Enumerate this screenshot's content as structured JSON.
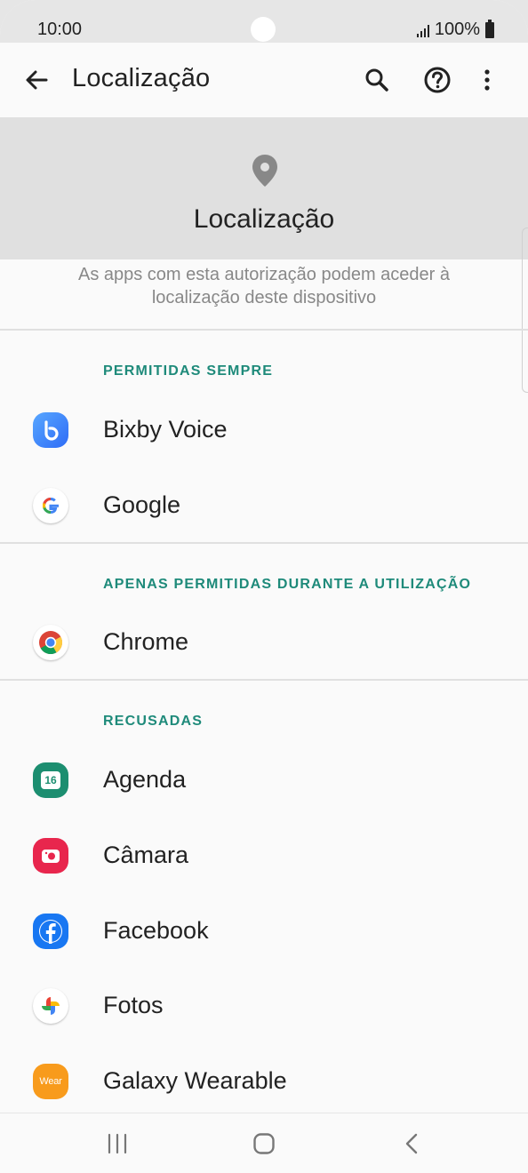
{
  "status": {
    "time": "10:00",
    "battery": "100%"
  },
  "appbar": {
    "title": "Localização",
    "icons": [
      "back-arrow-icon",
      "search-icon",
      "help-icon",
      "more-vert-icon"
    ]
  },
  "header": {
    "title": "Localização",
    "icon": "location-pin-icon"
  },
  "description": "As apps com esta autorização podem aceder à localização deste dispositivo",
  "sections": {
    "always": {
      "label": "PERMITIDAS SEMPRE",
      "apps": [
        {
          "name": "Bixby Voice",
          "icon": "bixby-voice-icon"
        },
        {
          "name": "Google",
          "icon": "google-icon"
        }
      ]
    },
    "while_using": {
      "label": "APENAS PERMITIDAS DURANTE A UTILIZAÇÃO",
      "apps": [
        {
          "name": "Chrome",
          "icon": "chrome-icon"
        }
      ]
    },
    "denied": {
      "label": "RECUSADAS",
      "apps": [
        {
          "name": "Agenda",
          "icon": "calendar-icon",
          "badge": "16"
        },
        {
          "name": "Câmara",
          "icon": "camera-icon"
        },
        {
          "name": "Facebook",
          "icon": "facebook-icon"
        },
        {
          "name": "Fotos",
          "icon": "photos-icon"
        },
        {
          "name": "Galaxy Wearable",
          "icon": "wear-icon",
          "badge": "Wear"
        }
      ]
    }
  },
  "colors": {
    "accent": "#1e8a7a",
    "header_bg": "#e0e0e0",
    "screen_bg": "#fafafa"
  },
  "navbar": {
    "icons": [
      "recent-apps-icon",
      "home-icon",
      "back-icon"
    ]
  }
}
